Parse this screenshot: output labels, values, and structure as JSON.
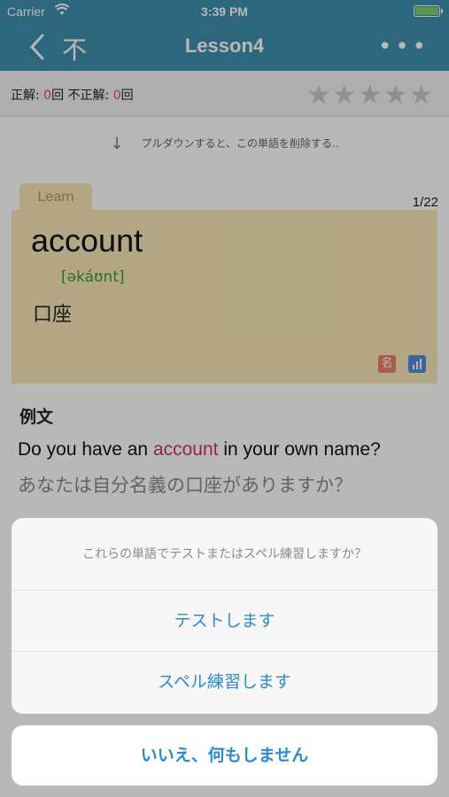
{
  "status": {
    "carrier": "Carrier",
    "time": "3:39 PM"
  },
  "nav": {
    "title": "Lesson4",
    "undo_glyph": "不",
    "more": "•••"
  },
  "score": {
    "correct_label": "正解: ",
    "correct_value": "0",
    "unit1": "回 ",
    "incorrect_label": "不正解: ",
    "incorrect_value": "0",
    "unit2": "回"
  },
  "stars": "★★★★★",
  "pull_hint": "プルダウンすると、この単語を削除する..",
  "card": {
    "tab_label": "Learn",
    "counter": "1/22",
    "word": "account",
    "phonetic": "[əkáʊnt]",
    "meaning": "口座",
    "pos_badge": "名"
  },
  "example": {
    "title": "例文",
    "en_before": "Do you have an ",
    "en_highlight": "account",
    "en_after": " in your own name?",
    "ja": "あなたは自分名義の口座がありますか？"
  },
  "sheet": {
    "message": "これらの単語でテストまたはスペル練習しますか？",
    "option_test": "テストします",
    "option_spell": "スペル練習します",
    "cancel": "いいえ、何もしません"
  }
}
